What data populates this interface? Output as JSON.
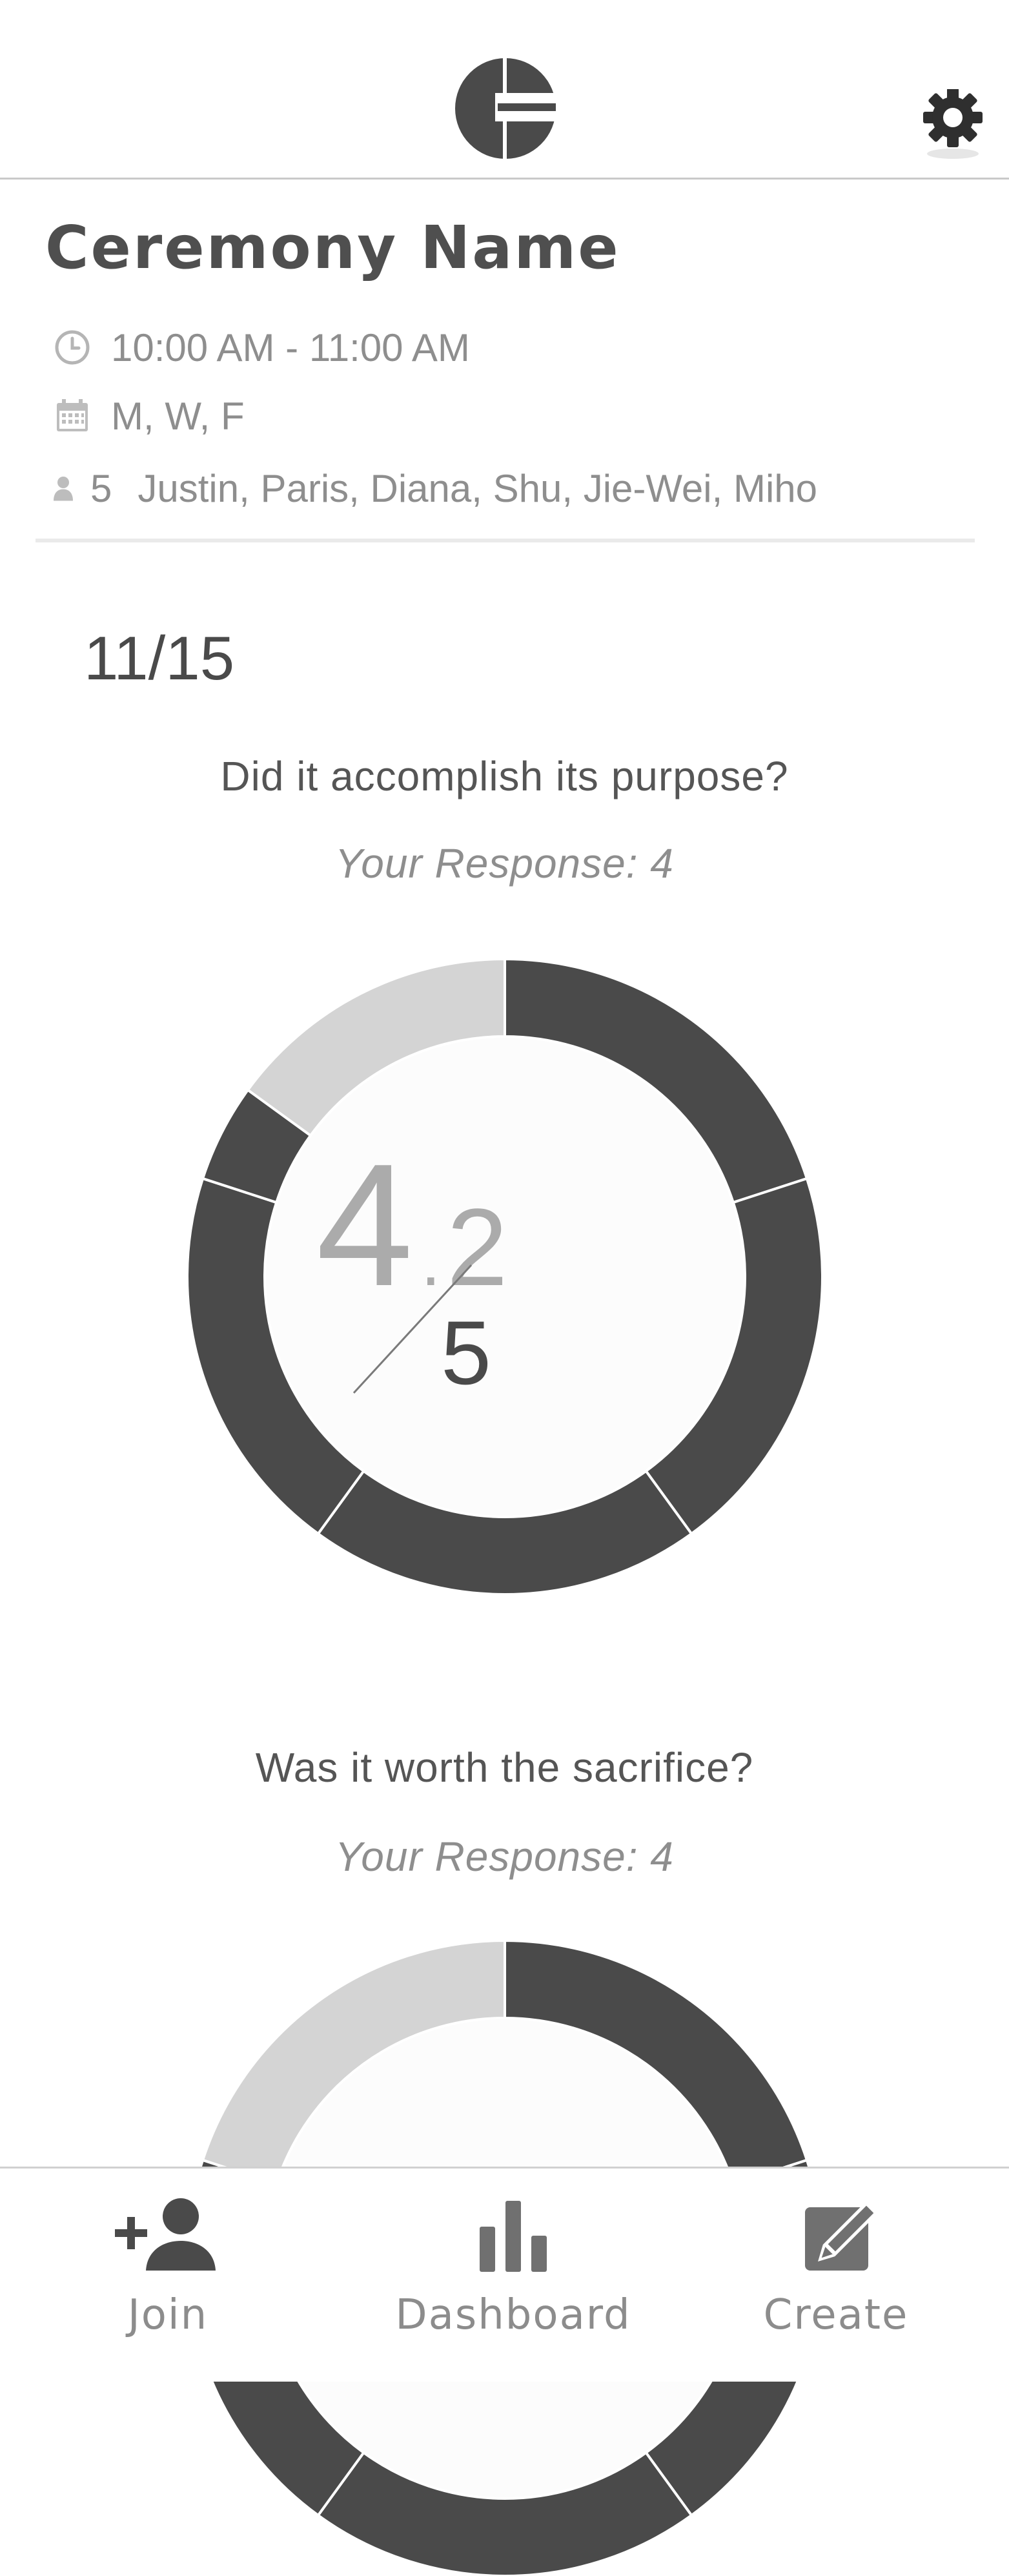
{
  "header": {
    "logo_icon": "app-logo",
    "settings_icon": "gear-icon"
  },
  "ceremony": {
    "name": "Ceremony Name",
    "time": "10:00 AM - 11:00 AM",
    "days": "M, W, F",
    "member_count": "5",
    "members": "Justin, Paris, Diana, Shu, Jie-Wei, Miho"
  },
  "entry": {
    "date": "11/15"
  },
  "questions": [
    {
      "question": "Did it accomplish its purpose?",
      "response": "Your Response: 4",
      "average": "4.2",
      "max": "5"
    },
    {
      "question": "Was it worth the sacrifice?",
      "response": "Your Response: 4"
    }
  ],
  "chart_data": [
    {
      "type": "pie",
      "variant": "donut",
      "question": "Did it accomplish its purpose?",
      "center_value": 4.2,
      "center_max": 5,
      "segments_filled": [
        0.2,
        0.2,
        0.2,
        0.2,
        0.05
      ],
      "segment_unfilled": 0.15,
      "colors": {
        "filled": "#4a4a4a",
        "unfilled": "#d4d4d4"
      }
    },
    {
      "type": "pie",
      "variant": "donut",
      "question": "Was it worth the sacrifice?",
      "segments_filled": [
        0.2,
        0.2,
        0.2,
        0.2
      ],
      "segment_unfilled": 0.2,
      "colors": {
        "filled": "#4a4a4a",
        "unfilled": "#d4d4d4"
      }
    }
  ],
  "bottom_nav": {
    "items": [
      {
        "label": "Join",
        "icon": "add-person-icon"
      },
      {
        "label": "Dashboard",
        "icon": "bar-chart-icon"
      },
      {
        "label": "Create",
        "icon": "edit-icon"
      }
    ]
  },
  "colors": {
    "dark": "#4a4a4a",
    "light": "#d4d4d4",
    "muted_text": "#8e8e8e",
    "divider": "#c9c9c9"
  }
}
